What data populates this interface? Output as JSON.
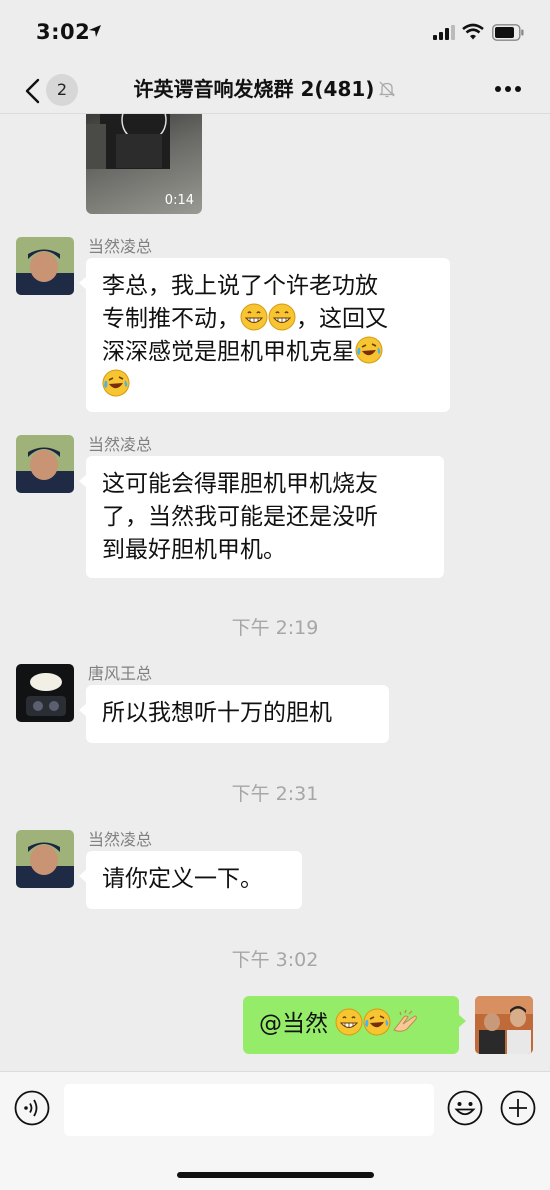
{
  "status_bar": {
    "time": "3:02"
  },
  "header": {
    "back_count": "2",
    "title": "许英谔音响发烧群 2(481)"
  },
  "video": {
    "duration": "0:14"
  },
  "messages": [
    {
      "sender": "当然凌总",
      "lines": [
        "李总，我上说了个许老功放",
        "专制推不动，",
        "，这回又",
        "深深感觉是胆机甲机克星"
      ]
    },
    {
      "sender": "当然凌总",
      "lines": [
        "这可能会得罪胆机甲机烧友",
        "了，当然我可能是还是没听",
        "到最好胆机甲机。"
      ]
    },
    {
      "timestamp": "下午 2:19"
    },
    {
      "sender": "唐风王总",
      "text": "所以我想听十万的胆机"
    },
    {
      "timestamp": "下午 2:31"
    },
    {
      "sender": "当然凌总",
      "text": "请你定义一下。"
    },
    {
      "timestamp": "下午 3:02"
    },
    {
      "sender": "me",
      "text": "@当然 "
    }
  ],
  "icons": [
    "location-arrow-icon",
    "signal-icon",
    "wifi-icon",
    "battery-icon",
    "back-chevron-icon",
    "mute-bell-icon",
    "more-icon",
    "voice-icon",
    "emoji-icon",
    "plus-icon",
    "grin-emoji",
    "laugh-cry-emoji",
    "clap-emoji"
  ]
}
